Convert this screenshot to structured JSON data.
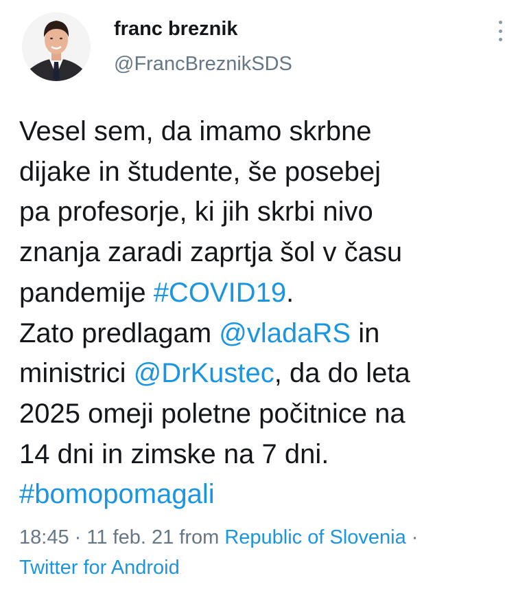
{
  "user": {
    "name": "franc breznik",
    "handle": "@FrancBreznikSDS"
  },
  "tweet": {
    "lines": [
      [
        {
          "text": "Vesel sem, da imamo skrbne",
          "type": "text"
        }
      ],
      [
        {
          "text": "dijake in študente, še posebej",
          "type": "text"
        }
      ],
      [
        {
          "text": "pa profesorje, ki jih skrbi nivo",
          "type": "text"
        }
      ],
      [
        {
          "text": "znanja zaradi zaprtja šol v času",
          "type": "text"
        }
      ],
      [
        {
          "text": "pandemije ",
          "type": "text"
        },
        {
          "text": "#COVID19",
          "type": "hashtag"
        },
        {
          "text": ".",
          "type": "text"
        }
      ],
      [
        {
          "text": "Zato predlagam ",
          "type": "text"
        },
        {
          "text": "@vladaRS",
          "type": "mention"
        },
        {
          "text": " in",
          "type": "text"
        }
      ],
      [
        {
          "text": "ministrici  ",
          "type": "text"
        },
        {
          "text": "@DrKustec",
          "type": "mention"
        },
        {
          "text": ", da do leta",
          "type": "text"
        }
      ],
      [
        {
          "text": "2025 omeji poletne počitnice na",
          "type": "text"
        }
      ],
      [
        {
          "text": "14 dni in zimske na 7 dni.",
          "type": "text"
        }
      ],
      [
        {
          "text": "#bomopomagali",
          "type": "hashtag"
        }
      ]
    ]
  },
  "meta": {
    "time": "18:45",
    "separator": " · ",
    "date": "11 feb. 21",
    "from_label": " from ",
    "location": "Republic of Slovenia",
    "trailing_separator": " ·",
    "source": "Twitter for Android"
  },
  "colors": {
    "link": "#1b95e0",
    "muted": "#657786",
    "text": "#14171a"
  },
  "icons": {
    "menu": "more-vertical-icon"
  }
}
